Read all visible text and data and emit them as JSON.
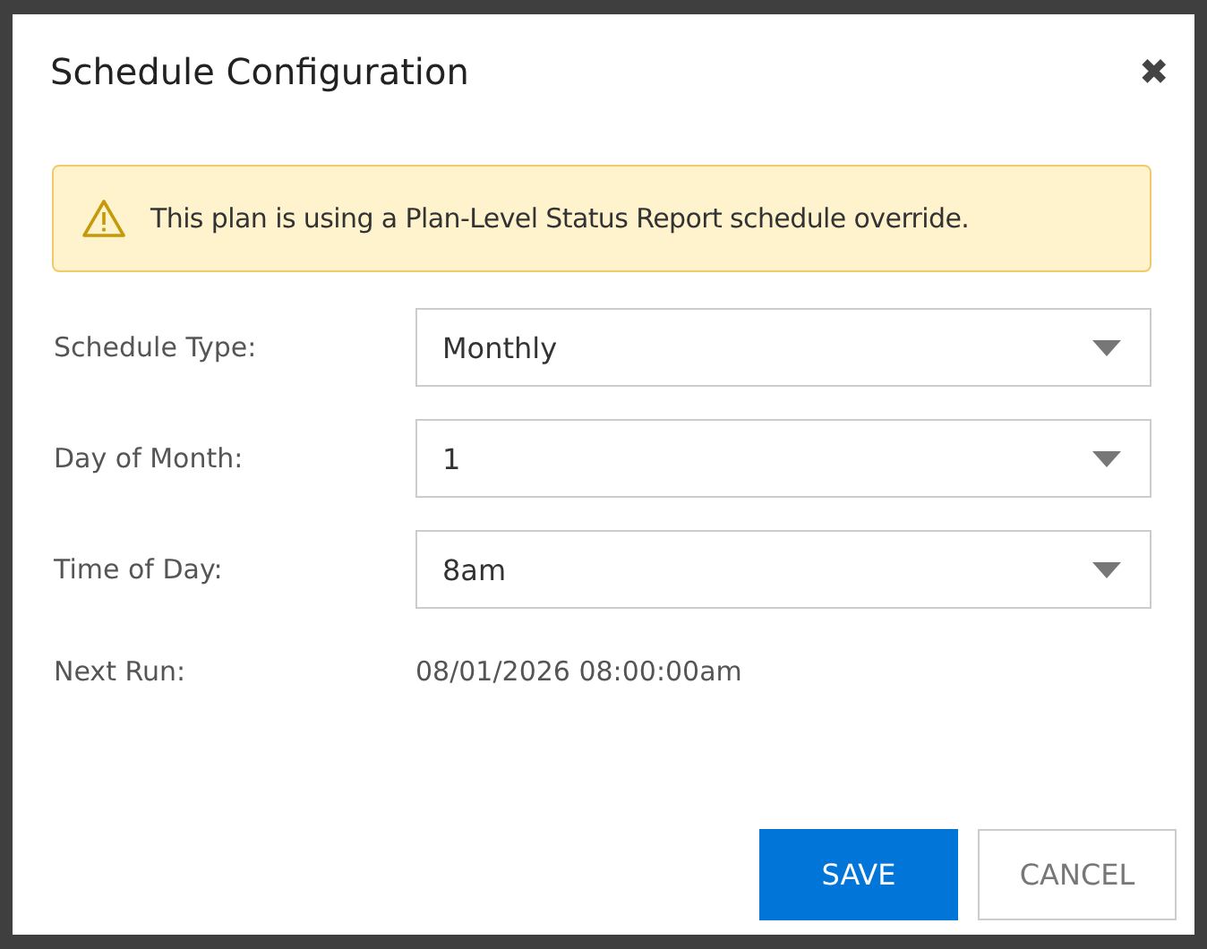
{
  "dialog": {
    "title": "Schedule Configuration",
    "close": "✖"
  },
  "alert": {
    "text": "This plan is using a Plan-Level Status Report schedule override."
  },
  "fields": [
    {
      "label": "Schedule Type:",
      "value": "Monthly"
    },
    {
      "label": "Day of Month:",
      "value": "1"
    },
    {
      "label": "Time of Day:",
      "value": "8am"
    }
  ],
  "next_run": {
    "label": "Next Run:",
    "value": "08/01/2026 08:00:00am"
  },
  "buttons": [
    {
      "label": "SAVE",
      "kind": "primary"
    },
    {
      "label": "CANCEL",
      "kind": "secondary"
    }
  ]
}
